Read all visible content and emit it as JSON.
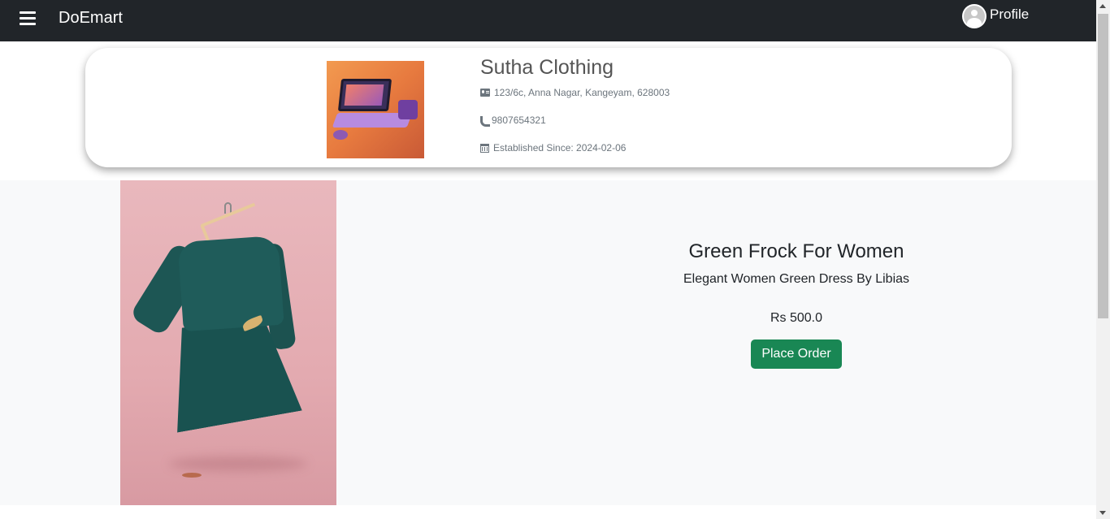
{
  "navbar": {
    "brand": "DoEmart",
    "menu_icon": "hamburger-menu-icon",
    "profile_icon": "user-avatar-icon",
    "profile_label": "Profile",
    "background": "#212529"
  },
  "store": {
    "name": "Sutha Clothing",
    "address": "123/6c, Anna Nagar, Kangeyam, 628003",
    "address_icon": "address-card-icon",
    "phone": "9807654321",
    "phone_icon": "phone-icon",
    "established": "Established Since: 2024-02-06",
    "established_icon": "calendar-icon",
    "logo_alt": "store-logo-laptop-image"
  },
  "product": {
    "title": "Green Frock For Women",
    "description": "Elegant Women Green Dress By Libias",
    "price": "Rs 500.0",
    "order_button": "Place Order",
    "image_alt": "green-frock-on-hanger-image"
  },
  "colors": {
    "primary_button": "#198754",
    "section_background": "#f8f9fa",
    "text_muted": "#6c757d"
  }
}
